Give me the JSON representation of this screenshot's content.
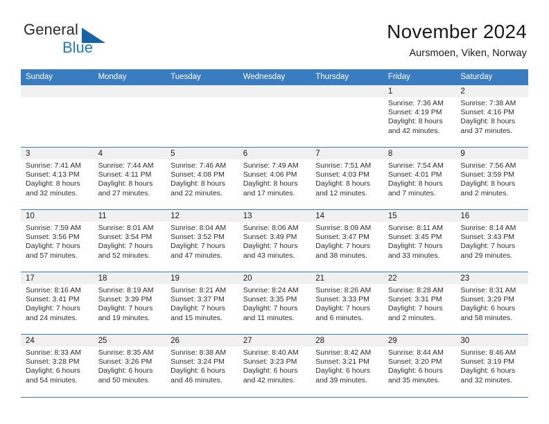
{
  "logo": {
    "word1": "General",
    "word2": "Blue",
    "triangle_color": "#1763a8",
    "blue_color": "#1e7ac4"
  },
  "header": {
    "title": "November 2024",
    "location": "Aursmoen, Viken, Norway"
  },
  "theme": {
    "header_bg": "#3a7cc0",
    "header_text": "#ffffff",
    "daynum_band_bg": "#f0f0f0",
    "grid_line": "#3a7cc0",
    "body_text": "#2c2c2c"
  },
  "weekday_headers": [
    "Sunday",
    "Monday",
    "Tuesday",
    "Wednesday",
    "Thursday",
    "Friday",
    "Saturday"
  ],
  "weeks": [
    [
      {
        "day": "",
        "lines": []
      },
      {
        "day": "",
        "lines": []
      },
      {
        "day": "",
        "lines": []
      },
      {
        "day": "",
        "lines": []
      },
      {
        "day": "",
        "lines": []
      },
      {
        "day": "1",
        "lines": [
          "Sunrise: 7:36 AM",
          "Sunset: 4:19 PM",
          "Daylight: 8 hours",
          "and 42 minutes."
        ]
      },
      {
        "day": "2",
        "lines": [
          "Sunrise: 7:38 AM",
          "Sunset: 4:16 PM",
          "Daylight: 8 hours",
          "and 37 minutes."
        ]
      }
    ],
    [
      {
        "day": "3",
        "lines": [
          "Sunrise: 7:41 AM",
          "Sunset: 4:13 PM",
          "Daylight: 8 hours",
          "and 32 minutes."
        ]
      },
      {
        "day": "4",
        "lines": [
          "Sunrise: 7:44 AM",
          "Sunset: 4:11 PM",
          "Daylight: 8 hours",
          "and 27 minutes."
        ]
      },
      {
        "day": "5",
        "lines": [
          "Sunrise: 7:46 AM",
          "Sunset: 4:08 PM",
          "Daylight: 8 hours",
          "and 22 minutes."
        ]
      },
      {
        "day": "6",
        "lines": [
          "Sunrise: 7:49 AM",
          "Sunset: 4:06 PM",
          "Daylight: 8 hours",
          "and 17 minutes."
        ]
      },
      {
        "day": "7",
        "lines": [
          "Sunrise: 7:51 AM",
          "Sunset: 4:03 PM",
          "Daylight: 8 hours",
          "and 12 minutes."
        ]
      },
      {
        "day": "8",
        "lines": [
          "Sunrise: 7:54 AM",
          "Sunset: 4:01 PM",
          "Daylight: 8 hours",
          "and 7 minutes."
        ]
      },
      {
        "day": "9",
        "lines": [
          "Sunrise: 7:56 AM",
          "Sunset: 3:59 PM",
          "Daylight: 8 hours",
          "and 2 minutes."
        ]
      }
    ],
    [
      {
        "day": "10",
        "lines": [
          "Sunrise: 7:59 AM",
          "Sunset: 3:56 PM",
          "Daylight: 7 hours",
          "and 57 minutes."
        ]
      },
      {
        "day": "11",
        "lines": [
          "Sunrise: 8:01 AM",
          "Sunset: 3:54 PM",
          "Daylight: 7 hours",
          "and 52 minutes."
        ]
      },
      {
        "day": "12",
        "lines": [
          "Sunrise: 8:04 AM",
          "Sunset: 3:52 PM",
          "Daylight: 7 hours",
          "and 47 minutes."
        ]
      },
      {
        "day": "13",
        "lines": [
          "Sunrise: 8:06 AM",
          "Sunset: 3:49 PM",
          "Daylight: 7 hours",
          "and 43 minutes."
        ]
      },
      {
        "day": "14",
        "lines": [
          "Sunrise: 8:09 AM",
          "Sunset: 3:47 PM",
          "Daylight: 7 hours",
          "and 38 minutes."
        ]
      },
      {
        "day": "15",
        "lines": [
          "Sunrise: 8:11 AM",
          "Sunset: 3:45 PM",
          "Daylight: 7 hours",
          "and 33 minutes."
        ]
      },
      {
        "day": "16",
        "lines": [
          "Sunrise: 8:14 AM",
          "Sunset: 3:43 PM",
          "Daylight: 7 hours",
          "and 29 minutes."
        ]
      }
    ],
    [
      {
        "day": "17",
        "lines": [
          "Sunrise: 8:16 AM",
          "Sunset: 3:41 PM",
          "Daylight: 7 hours",
          "and 24 minutes."
        ]
      },
      {
        "day": "18",
        "lines": [
          "Sunrise: 8:19 AM",
          "Sunset: 3:39 PM",
          "Daylight: 7 hours",
          "and 19 minutes."
        ]
      },
      {
        "day": "19",
        "lines": [
          "Sunrise: 8:21 AM",
          "Sunset: 3:37 PM",
          "Daylight: 7 hours",
          "and 15 minutes."
        ]
      },
      {
        "day": "20",
        "lines": [
          "Sunrise: 8:24 AM",
          "Sunset: 3:35 PM",
          "Daylight: 7 hours",
          "and 11 minutes."
        ]
      },
      {
        "day": "21",
        "lines": [
          "Sunrise: 8:26 AM",
          "Sunset: 3:33 PM",
          "Daylight: 7 hours",
          "and 6 minutes."
        ]
      },
      {
        "day": "22",
        "lines": [
          "Sunrise: 8:28 AM",
          "Sunset: 3:31 PM",
          "Daylight: 7 hours",
          "and 2 minutes."
        ]
      },
      {
        "day": "23",
        "lines": [
          "Sunrise: 8:31 AM",
          "Sunset: 3:29 PM",
          "Daylight: 6 hours",
          "and 58 minutes."
        ]
      }
    ],
    [
      {
        "day": "24",
        "lines": [
          "Sunrise: 8:33 AM",
          "Sunset: 3:28 PM",
          "Daylight: 6 hours",
          "and 54 minutes."
        ]
      },
      {
        "day": "25",
        "lines": [
          "Sunrise: 8:35 AM",
          "Sunset: 3:26 PM",
          "Daylight: 6 hours",
          "and 50 minutes."
        ]
      },
      {
        "day": "26",
        "lines": [
          "Sunrise: 8:38 AM",
          "Sunset: 3:24 PM",
          "Daylight: 6 hours",
          "and 46 minutes."
        ]
      },
      {
        "day": "27",
        "lines": [
          "Sunrise: 8:40 AM",
          "Sunset: 3:23 PM",
          "Daylight: 6 hours",
          "and 42 minutes."
        ]
      },
      {
        "day": "28",
        "lines": [
          "Sunrise: 8:42 AM",
          "Sunset: 3:21 PM",
          "Daylight: 6 hours",
          "and 39 minutes."
        ]
      },
      {
        "day": "29",
        "lines": [
          "Sunrise: 8:44 AM",
          "Sunset: 3:20 PM",
          "Daylight: 6 hours",
          "and 35 minutes."
        ]
      },
      {
        "day": "30",
        "lines": [
          "Sunrise: 8:46 AM",
          "Sunset: 3:19 PM",
          "Daylight: 6 hours",
          "and 32 minutes."
        ]
      }
    ]
  ]
}
